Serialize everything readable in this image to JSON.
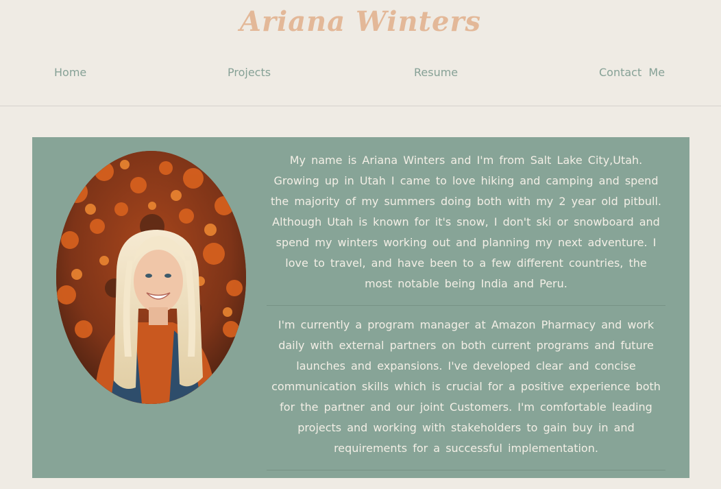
{
  "header": {
    "site_title": "Ariana Winters"
  },
  "nav": {
    "items": [
      {
        "label": "Home"
      },
      {
        "label": "Projects"
      },
      {
        "label": "Resume"
      },
      {
        "label": "Contact  Me"
      }
    ]
  },
  "about": {
    "paragraphs": [
      "My name is Ariana Winters and I'm from Salt Lake City,Utah. Growing up in Utah I came to love hiking and camping and spend the majority of my summers doing both with my 2 year old pitbull. Although Utah is known for it's snow, I don't ski or snowboard and spend my winters working out and planning my next adventure. I love to travel, and have been to a few different countries, the most notable being India and Peru.",
      "I'm currently a program manager at Amazon Pharmacy and work daily with external partners on both current programs and future launches and expansions. I've developed clear and concise communication skills which is crucial for a positive experience both for the partner and our joint Customers. I'm comfortable leading projects and working with stakeholders to gain buy in and requirements for a successful implementation."
    ]
  },
  "colors": {
    "background": "#efebe4",
    "title": "#e3b898",
    "nav": "#86a196",
    "panel": "#87a497",
    "panel_text": "#f3efe6"
  }
}
